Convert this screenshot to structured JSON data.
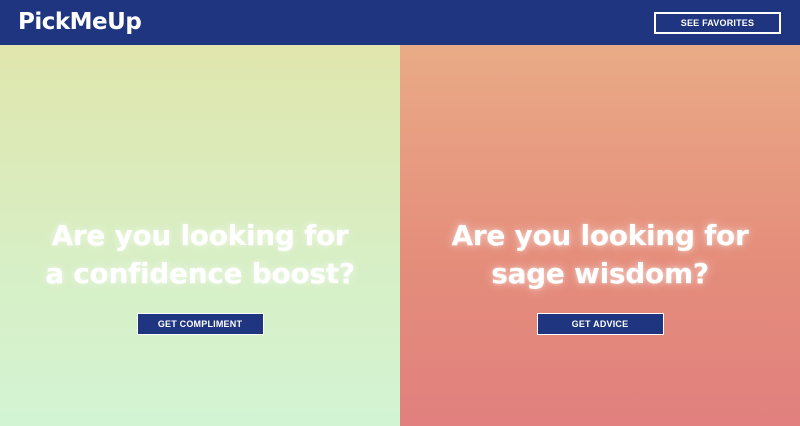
{
  "header": {
    "logo_text": "PickMeUp",
    "favorites_label": "SEE FAVORITES"
  },
  "compliment_panel": {
    "heading_line1": "Are you looking for",
    "heading_line2": "a confidence boost?",
    "button_label": "GET COMPLIMENT"
  },
  "advice_panel": {
    "heading_line1": "Are you looking for",
    "heading_line2": "sage wisdom?",
    "button_label": "GET ADVICE"
  },
  "colors": {
    "brand_navy": "#1f3580",
    "compliment_gradient_top": "#e0e6ad",
    "compliment_gradient_bottom": "#d3f4d3",
    "advice_gradient_top": "#e9ab87",
    "advice_gradient_bottom": "#e1807e"
  }
}
